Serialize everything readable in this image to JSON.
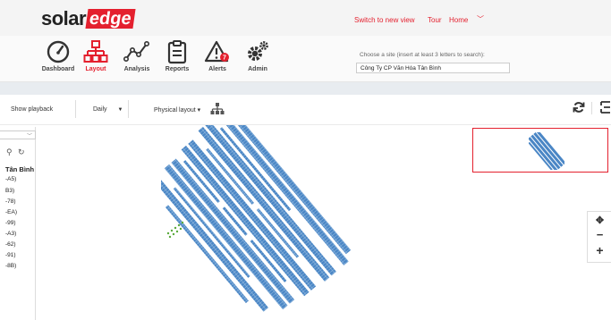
{
  "header": {
    "logo": {
      "solar": "solar",
      "edge": "edge"
    },
    "links": {
      "switch_view": "Switch to new view",
      "tour": "Tour",
      "home": "Home",
      "caret": "﹀"
    },
    "accent": "#e4202e"
  },
  "nav": {
    "items": [
      {
        "label": "Dashboard",
        "icon": "gauge-icon"
      },
      {
        "label": "Layout",
        "icon": "sitemap-icon",
        "active": true
      },
      {
        "label": "Analysis",
        "icon": "line-chart-icon"
      },
      {
        "label": "Reports",
        "icon": "clipboard-icon"
      },
      {
        "label": "Alerts",
        "icon": "warning-icon",
        "badge": "7"
      },
      {
        "label": "Admin",
        "icon": "gears-icon"
      }
    ]
  },
  "site_search": {
    "prompt": "Choose a site (insert at least 3 letters to search):",
    "value": "Công Ty CP Văn Hóa Tân Bình"
  },
  "toolbar": {
    "show_playback": "Show playback",
    "period": "Daily",
    "period_caret": "▼",
    "layout": "Physical layout ▾"
  },
  "left_panel": {
    "title": "Tân Bình",
    "rows": [
      "-A5)",
      "B3)",
      "-78)",
      "-EA)",
      "-99)",
      "-A3)",
      "-62)",
      "-91)",
      "-8B)"
    ]
  },
  "zoom": {
    "move": "✥",
    "minus": "−",
    "plus": "+"
  }
}
